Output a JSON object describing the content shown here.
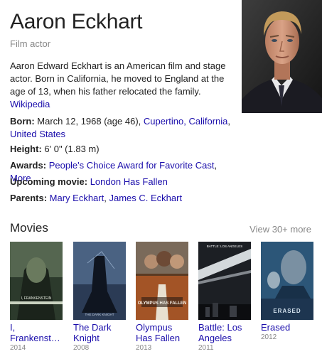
{
  "person": {
    "name": "Aaron Eckhart",
    "subtitle": "Film actor",
    "description": "Aaron Edward Eckhart is an American film and stage actor. Born in California, he moved to England at the age of 13, when his father relocated the family.",
    "source_link": "Wikipedia"
  },
  "facts": {
    "born": {
      "label": "Born:",
      "text": " March 12, 1968 (age 46), ",
      "place1": "Cupertino, California",
      "sep": ", ",
      "place2": "United States"
    },
    "height": {
      "label": "Height:",
      "text": " 6' 0\" (1.83 m)"
    },
    "awards": {
      "label": "Awards:",
      "link1": "People's Choice Award for Favorite Cast",
      "sep": ", ",
      "link2": "More"
    },
    "upcoming": {
      "label": "Upcoming movie:",
      "link1": "London Has Fallen"
    },
    "parents": {
      "label": "Parents:",
      "link1": "Mary Eckhart",
      "sep": ", ",
      "link2": "James C. Eckhart"
    }
  },
  "movies": {
    "header": "Movies",
    "view_more": "View 30+ more",
    "items": [
      {
        "title_line1": "I,",
        "title_line2": "Frankenst…",
        "year": "2014",
        "poster_text": "I, FRANKENSTEIN"
      },
      {
        "title_line1": "The Dark",
        "title_line2": "Knight",
        "year": "2008",
        "poster_text": "THE DARK KNIGHT"
      },
      {
        "title_line1": "Olympus",
        "title_line2": "Has Fallen",
        "year": "2013",
        "poster_text": "OLYMPUS HAS FALLEN"
      },
      {
        "title_line1": "Battle: Los",
        "title_line2": "Angeles",
        "year": "2011",
        "poster_text": "BATTLE: LOS ANGELES"
      },
      {
        "title_line1": "Erased",
        "title_line2": "",
        "year": "2012",
        "poster_text": "ERASED"
      }
    ]
  }
}
